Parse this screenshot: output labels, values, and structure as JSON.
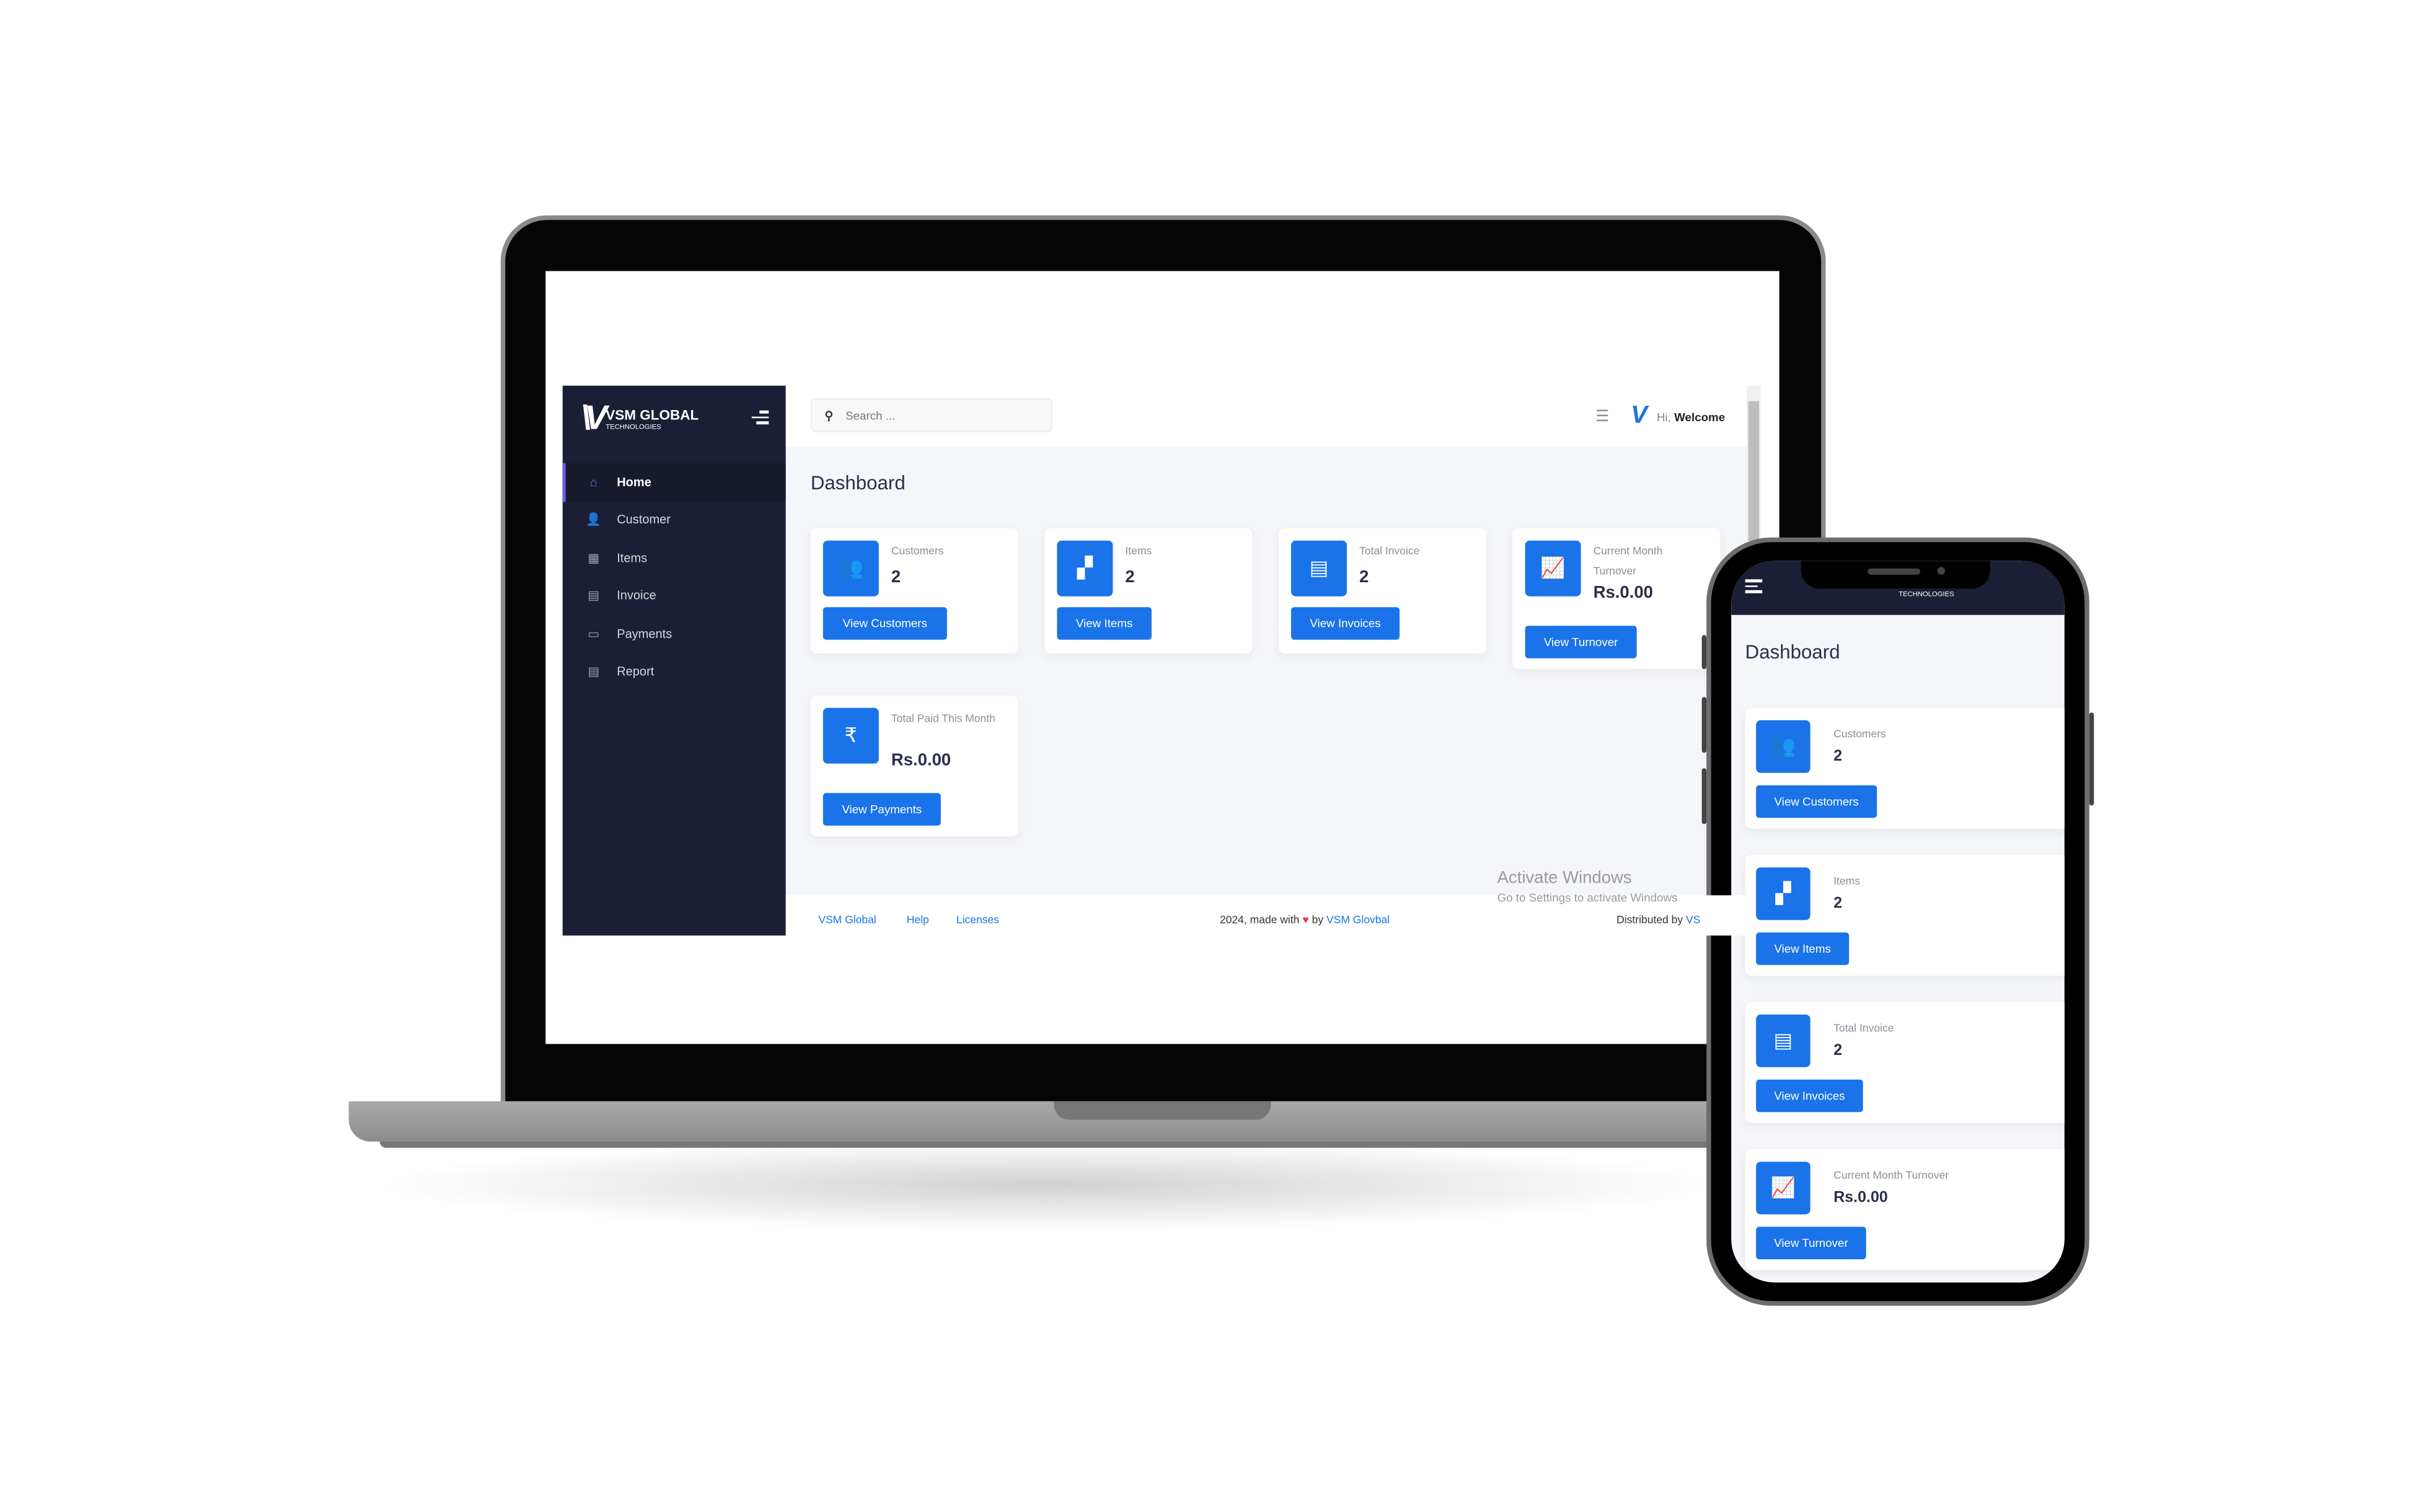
{
  "brand": {
    "name": "VSM GLOBAL",
    "tagline": "TECHNOLOGIES"
  },
  "sidebar": {
    "items": [
      {
        "label": "Home",
        "icon": "home-icon",
        "glyph": "⌂",
        "active": true
      },
      {
        "label": "Customer",
        "icon": "user-icon",
        "glyph": "👤"
      },
      {
        "label": "Items",
        "icon": "box-icon",
        "glyph": "▦"
      },
      {
        "label": "Invoice",
        "icon": "invoice-icon",
        "glyph": "▤"
      },
      {
        "label": "Payments",
        "icon": "credit-card-icon",
        "glyph": "▭"
      },
      {
        "label": "Report",
        "icon": "report-icon",
        "glyph": "▤"
      }
    ]
  },
  "topbar": {
    "search_placeholder": "Search ...",
    "greeting": "Hi,",
    "user": "Welcome"
  },
  "page_title": "Dashboard",
  "cards": [
    {
      "label": "Customers",
      "value": "2",
      "button": "View Customers",
      "icon": "users-icon",
      "glyph": "👥"
    },
    {
      "label": "Items",
      "value": "2",
      "button": "View Items",
      "icon": "boxes-icon",
      "glyph": "▞"
    },
    {
      "label": "Total Invoice",
      "value": "2",
      "button": "View Invoices",
      "icon": "file-icon",
      "glyph": "▤"
    },
    {
      "label": "Current Month Turnover",
      "value": "Rs.0.00",
      "button": "View Turnover",
      "icon": "chart-line-icon",
      "glyph": "📈"
    },
    {
      "label": "Total Paid This Month",
      "value": "Rs.0.00",
      "button": "View Payments",
      "icon": "rupee-icon",
      "glyph": "₹"
    }
  ],
  "footer": {
    "links": [
      "VSM Global",
      "Help",
      "Licenses"
    ],
    "credit_prefix": "2024, made with",
    "credit_by": "by",
    "credit_link": "VSM Glovbal",
    "distributed": "Distributed by",
    "distributed_link": "VS"
  },
  "watermark": {
    "title": "Activate Windows",
    "subtitle": "Go to Settings to activate Windows"
  },
  "colors": {
    "accent": "#1a73e8",
    "sidebar": "#1b1f36",
    "background": "#f5f6fa"
  }
}
